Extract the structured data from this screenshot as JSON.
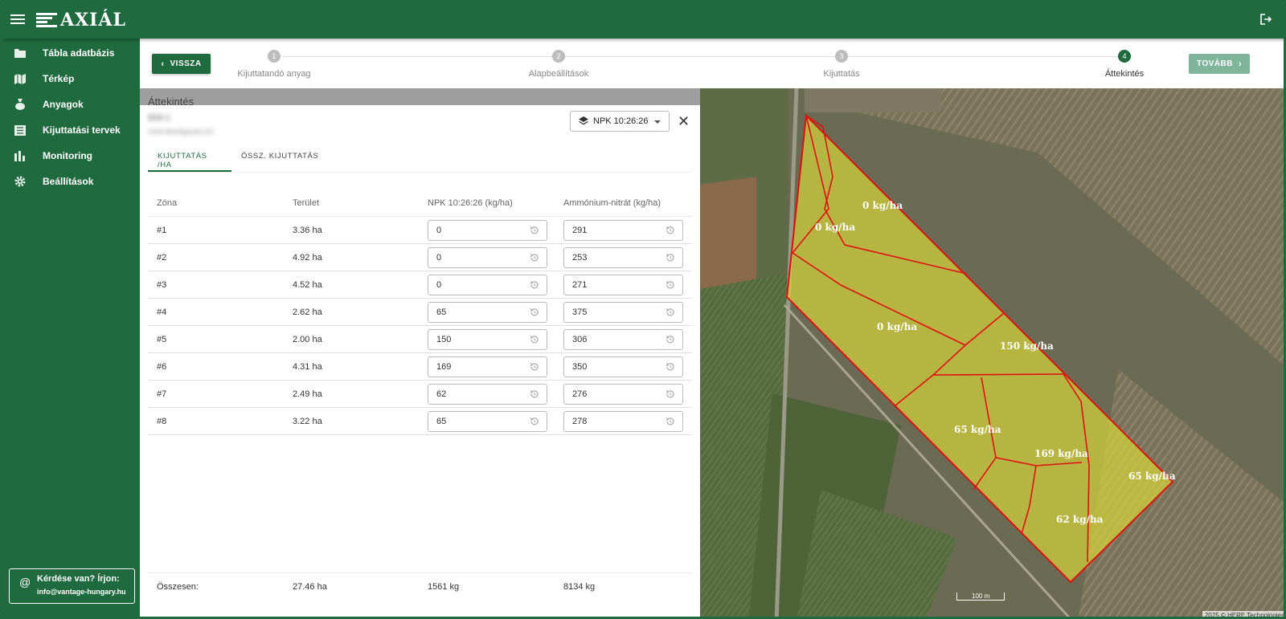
{
  "app": {
    "brand": "AXIÁL"
  },
  "sidebar": {
    "items": [
      {
        "label": "Tábla adatbázis",
        "icon": "folder-icon"
      },
      {
        "label": "Térkép",
        "icon": "map-icon"
      },
      {
        "label": "Anyagok",
        "icon": "bag-icon"
      },
      {
        "label": "Kijuttatási tervek",
        "icon": "list-icon"
      },
      {
        "label": "Monitoring",
        "icon": "bar-chart-icon"
      },
      {
        "label": "Beállítások",
        "icon": "gear-icon"
      }
    ],
    "help": {
      "title": "Kérdése van? Írjon:",
      "email": "info@vantage-hungary.hu"
    }
  },
  "stepper": {
    "back_label": "VISSZA",
    "next_label": "TOVÁBB",
    "steps": [
      {
        "num": "1",
        "label": "Kijuttatandó anyag",
        "active": false
      },
      {
        "num": "2",
        "label": "Alapbeállítások",
        "active": false
      },
      {
        "num": "3",
        "label": "Kijuttatás",
        "active": false
      },
      {
        "num": "4",
        "label": "Áttekintés",
        "active": true
      }
    ]
  },
  "panel": {
    "title": "Áttekintés",
    "field_name": "808-1",
    "field_sub": "Hold Meofigazda 2/1",
    "material_select": "NPK 10:26:26",
    "tabs": [
      "KIJUTTATÁS /HA",
      "ÖSSZ. KIJUTTATÁS"
    ],
    "columns": [
      "Zóna",
      "Terület",
      "NPK 10:26:26  (kg/ha)",
      "Ammónium-nitrát  (kg/ha)"
    ],
    "rows": [
      {
        "zone": "#1",
        "area": "3.36 ha",
        "npk": "0",
        "an": "291"
      },
      {
        "zone": "#2",
        "area": "4.92 ha",
        "npk": "0",
        "an": "253"
      },
      {
        "zone": "#3",
        "area": "4.52 ha",
        "npk": "0",
        "an": "271"
      },
      {
        "zone": "#4",
        "area": "2.62 ha",
        "npk": "65",
        "an": "375"
      },
      {
        "zone": "#5",
        "area": "2.00 ha",
        "npk": "150",
        "an": "306"
      },
      {
        "zone": "#6",
        "area": "4.31 ha",
        "npk": "169",
        "an": "350"
      },
      {
        "zone": "#7",
        "area": "2.49 ha",
        "npk": "62",
        "an": "276"
      },
      {
        "zone": "#8",
        "area": "3.22 ha",
        "npk": "65",
        "an": "278"
      }
    ],
    "total": {
      "label": "Összesen:",
      "area": "27.46 ha",
      "npk": "1561 kg",
      "an": "8134 kg"
    }
  },
  "map": {
    "zone_labels": [
      "0 kg/ha",
      "0 kg/ha",
      "0 kg/ha",
      "150 kg/ha",
      "65 kg/ha",
      "169 kg/ha",
      "65 kg/ha",
      "62 kg/ha"
    ],
    "scale": "100 m",
    "credit": "2025 © HERE Technologies",
    "colors": {
      "zone_fill": "#d4d23a",
      "zone_border": "#e01010",
      "brand": "#1f6b3f"
    }
  }
}
